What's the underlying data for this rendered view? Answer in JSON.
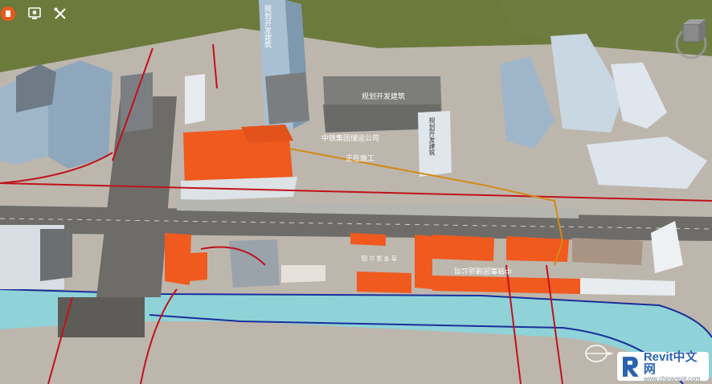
{
  "labels": {
    "tower_label": "规划开发建筑",
    "block_label": "规划开发建筑",
    "small_label": "规划开发建筑",
    "company_label": "中铁集团储运公司",
    "construction_label": "正在施工",
    "signage_1": "中铁集团储运公司",
    "signage_2": "苦 苓 溪 公 园"
  },
  "watermark": {
    "brand": "Revit中文网",
    "url": "www.chinarevit.com"
  },
  "icons": {
    "app": "app-logo-icon",
    "screenshot": "screenshot-icon",
    "tools": "tools-icon",
    "viewcube": "viewcube-icon",
    "compass": "compass-icon"
  },
  "colors": {
    "ground": "#bdb6ad",
    "grass": "#6c7a3c",
    "river": "#8fd3d8",
    "orange_building": "#f05a1e",
    "road": "#6d6c69",
    "red_line": "#c0121b",
    "blue_line": "#1a2e9a"
  }
}
